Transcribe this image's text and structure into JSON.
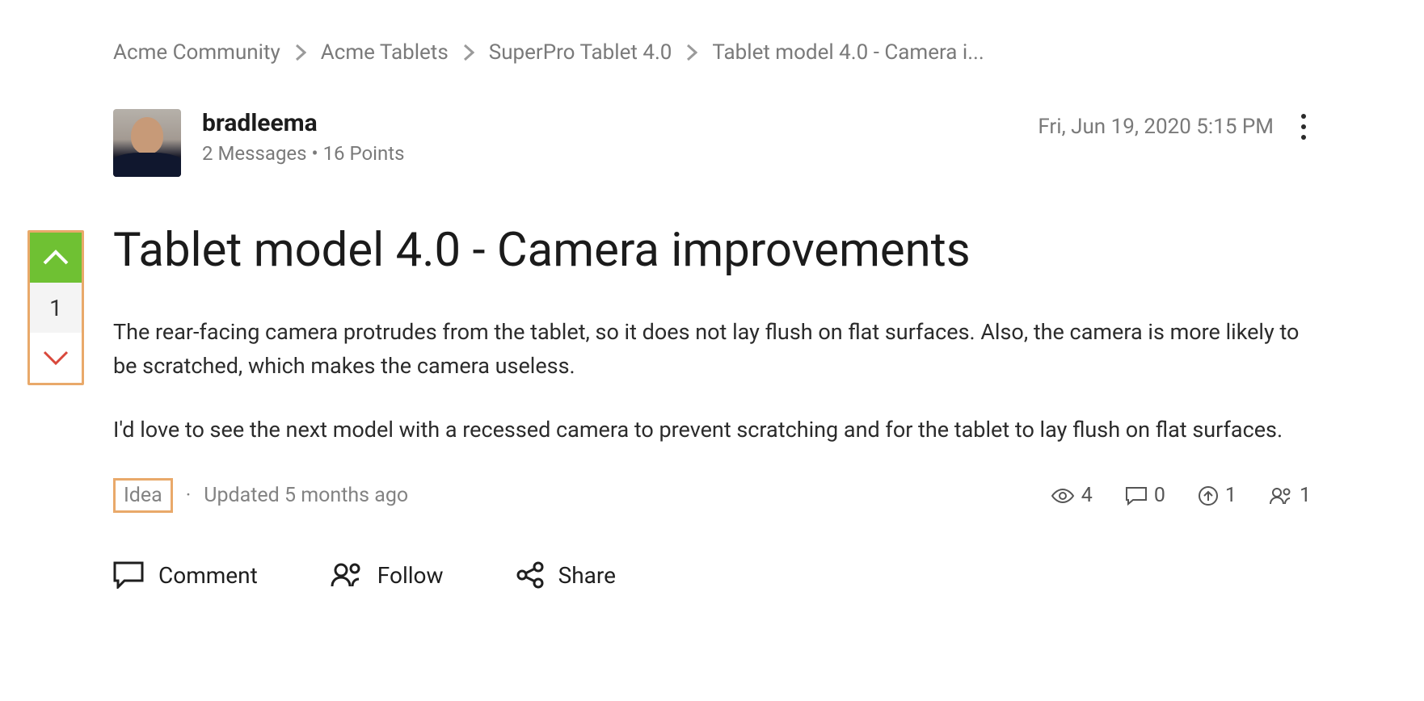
{
  "breadcrumbs": {
    "items": [
      "Acme Community",
      "Acme Tablets",
      "SuperPro Tablet 4.0",
      "Tablet model 4.0 - Camera i..."
    ]
  },
  "author": {
    "name": "bradleema",
    "messages_label": "2 Messages",
    "points_label": "16 Points",
    "separator": " • "
  },
  "post": {
    "timestamp": "Fri, Jun 19, 2020 5:15 PM",
    "title": "Tablet model 4.0 - Camera improvements",
    "body_p1": "The rear-facing camera protrudes from the tablet, so it does not lay flush on flat surfaces. Also, the camera is more likely to be scratched, which makes the camera useless.",
    "body_p2": "I'd love to see the next model with a recessed camera to prevent scratching and for the tablet to lay flush on flat surfaces."
  },
  "vote": {
    "count": "1"
  },
  "meta": {
    "tag": "Idea",
    "updated": "Updated 5 months ago"
  },
  "stats": {
    "views": "4",
    "comments": "0",
    "upvotes": "1",
    "followers": "1"
  },
  "actions": {
    "comment": "Comment",
    "follow": "Follow",
    "share": "Share"
  },
  "colors": {
    "highlight_border": "#e9a96a",
    "vote_up_bg": "#6fc133"
  }
}
